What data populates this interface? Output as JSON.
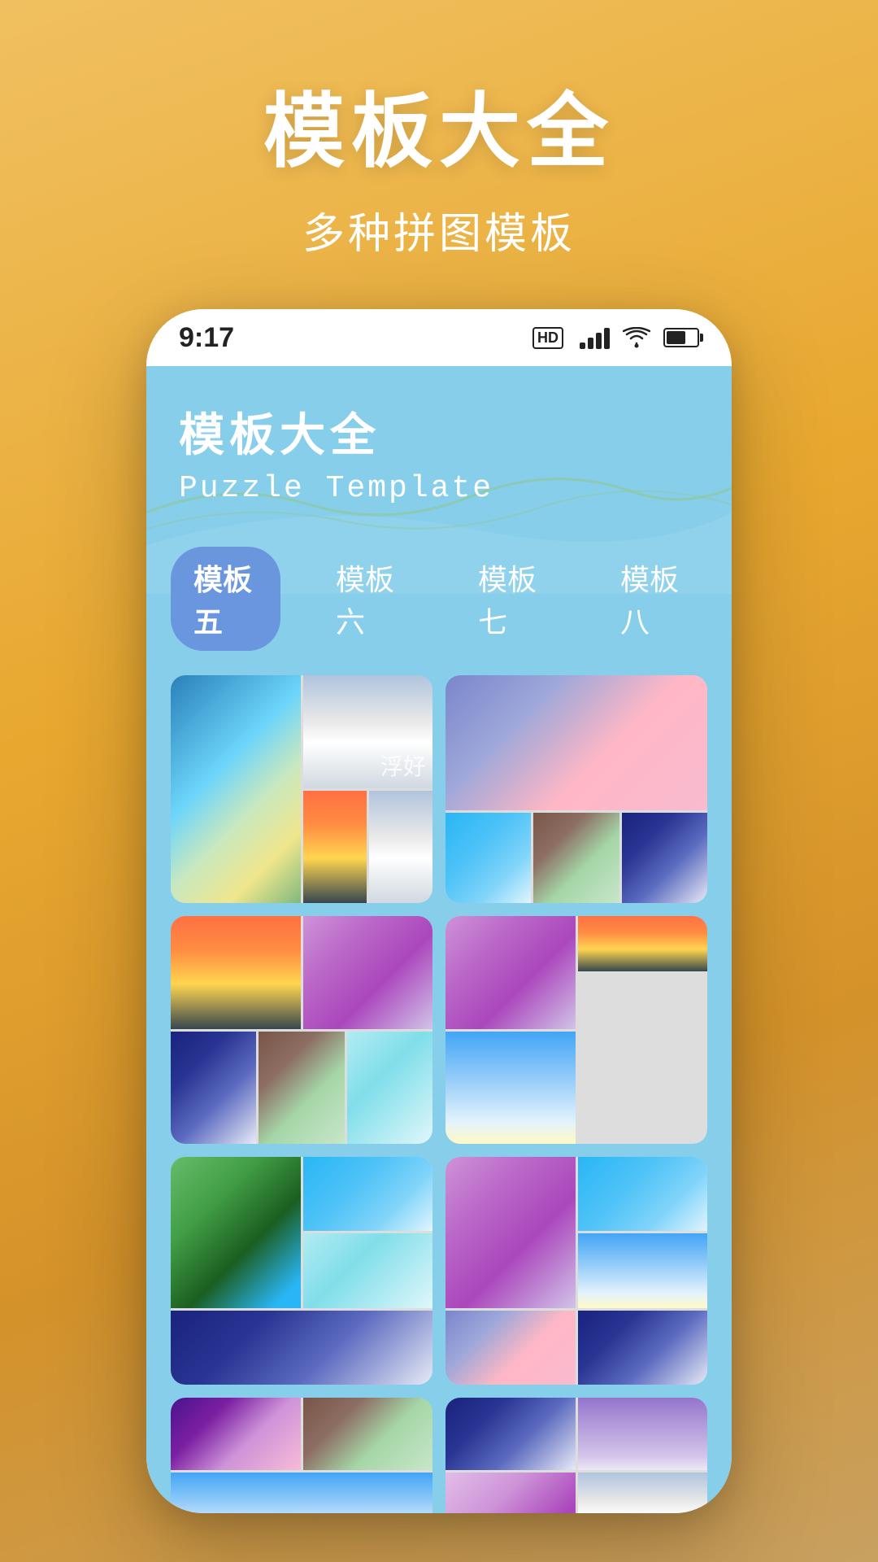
{
  "hero": {
    "title": "模板大全",
    "subtitle": "多种拼图模板"
  },
  "statusBar": {
    "time": "9:17",
    "hd": "HD"
  },
  "app": {
    "titleCn": "模板大全",
    "titleEn": "Puzzle Template"
  },
  "tabs": [
    {
      "id": "tab5",
      "label": "模板五",
      "active": true
    },
    {
      "id": "tab6",
      "label": "模板六",
      "active": false
    },
    {
      "id": "tab7",
      "label": "模板七",
      "active": false
    },
    {
      "id": "tab8",
      "label": "模板八",
      "active": false
    }
  ]
}
